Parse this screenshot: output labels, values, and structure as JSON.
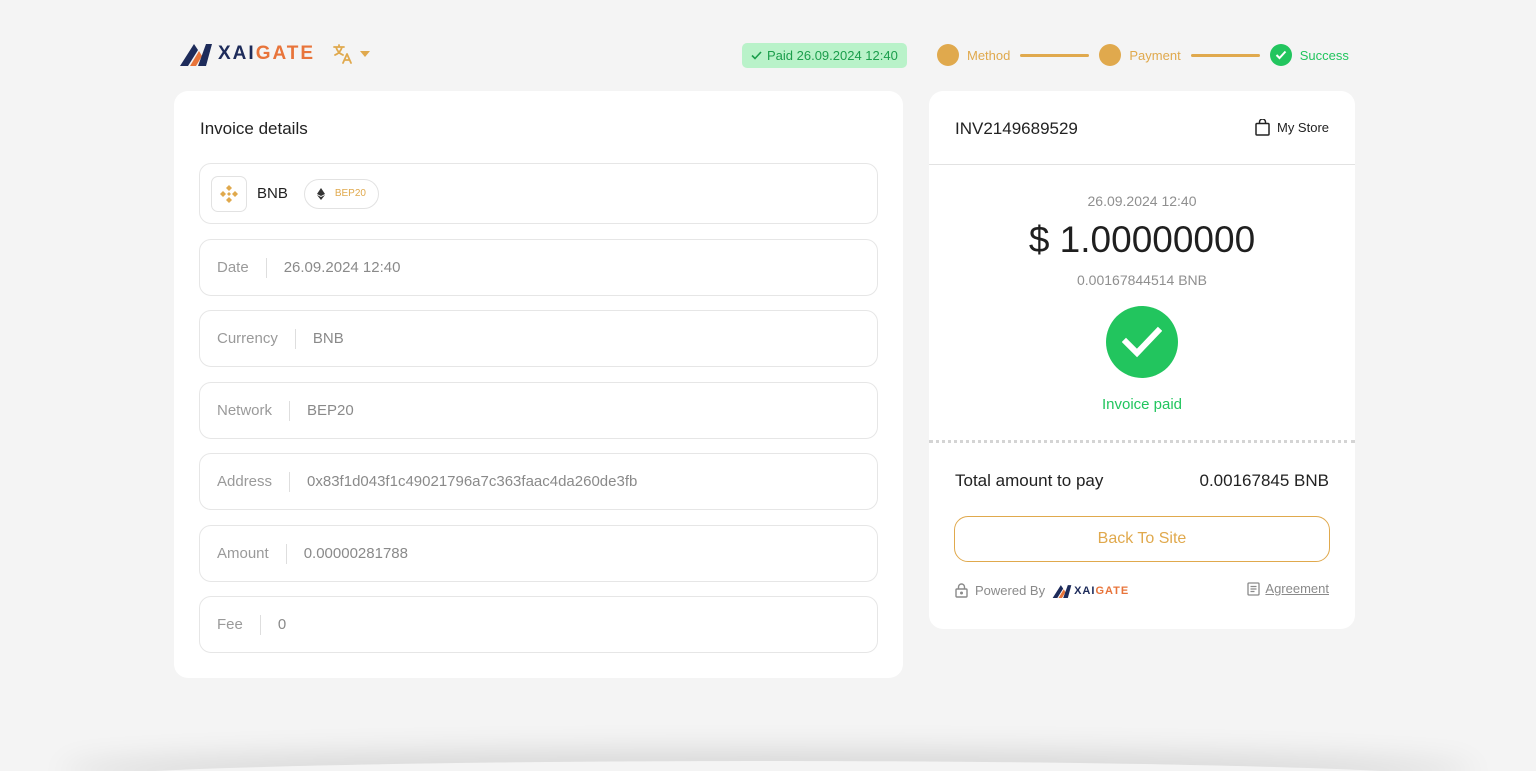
{
  "header": {
    "logo": {
      "part1": "XAI",
      "part2": "GATE"
    },
    "language_icon": "translate-icon",
    "paid_badge": "Paid 26.09.2024 12:40",
    "steps": [
      {
        "label": "Method",
        "status": "completed"
      },
      {
        "label": "Payment",
        "status": "completed"
      },
      {
        "label": "Success",
        "status": "current"
      }
    ]
  },
  "invoice_details": {
    "title": "Invoice details",
    "coin": {
      "name": "BNB",
      "network": "BEP20"
    },
    "fields": [
      {
        "label": "Date",
        "value": "26.09.2024 12:40"
      },
      {
        "label": "Currency",
        "value": "BNB"
      },
      {
        "label": "Network",
        "value": "BEP20"
      },
      {
        "label": "Address",
        "value": "0x83f1d043f1c49021796a7c363faac4da260de3fb"
      },
      {
        "label": "Amount",
        "value": "0.00000281788"
      },
      {
        "label": "Fee",
        "value": "0"
      }
    ]
  },
  "summary": {
    "invoice_id": "INV2149689529",
    "store_label": "My Store",
    "date": "26.09.2024 12:40",
    "amount_usd": "$ 1.00000000",
    "amount_crypto": "0.00167844514 BNB",
    "status_text": "Invoice paid",
    "total_label": "Total amount to pay",
    "total_value": "0.00167845 BNB",
    "back_button": "Back To Site",
    "powered_by": "Powered By",
    "powered_logo": {
      "part1": "XAI",
      "part2": "GATE"
    },
    "agreement": "Agreement"
  },
  "colors": {
    "accent": "#e0a94d",
    "success": "#22c55e",
    "brand_dark": "#1d2b5a",
    "brand_orange": "#e8743a"
  }
}
